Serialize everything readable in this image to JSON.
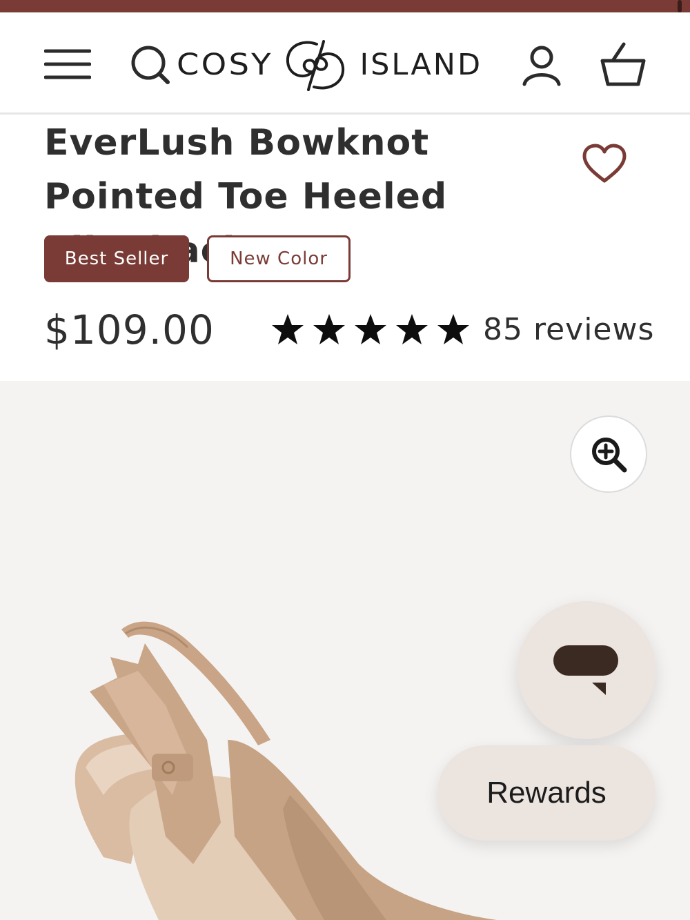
{
  "colors": {
    "brand": "#7a3b36",
    "text": "#2f2f2f",
    "chat_bubble": "#3b2a22",
    "floating_button_bg": "#ece4df",
    "gallery_bg": "#f5f3f1"
  },
  "header": {
    "logo_left": "COSY",
    "logo_right": "ISLAND",
    "icons": [
      "menu-icon",
      "search-icon",
      "account-icon",
      "cart-icon"
    ]
  },
  "product": {
    "title": "EverLush Bowknot Pointed Toe Heeled Slingback",
    "badges": [
      "Best Seller",
      "New Color"
    ],
    "price": "$109.00",
    "rating": 5,
    "reviews_label": "85 reviews"
  },
  "gallery": {
    "zoom_icon": "zoom-in-icon"
  },
  "floating": {
    "chat_icon": "chat-bubble-icon",
    "rewards_label": "Rewards"
  }
}
